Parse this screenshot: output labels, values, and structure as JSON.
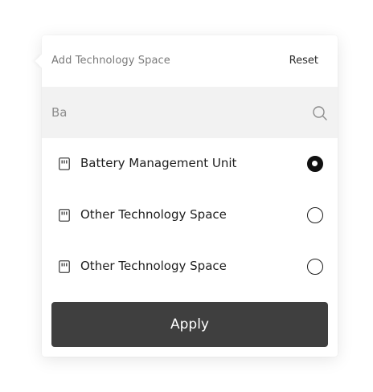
{
  "popover": {
    "title": "Add Technology Space",
    "reset_label": "Reset"
  },
  "search": {
    "value": "Ba",
    "icon": "search-icon"
  },
  "options": [
    {
      "label": "Battery Management Unit",
      "icon": "device-icon",
      "selected": true
    },
    {
      "label": "Other Technology Space",
      "icon": "device-icon",
      "selected": false
    },
    {
      "label": "Other Technology Space",
      "icon": "device-icon",
      "selected": false
    }
  ],
  "apply_label": "Apply",
  "colors": {
    "button_bg": "#3f3f3f",
    "search_bg": "#f2f2f2",
    "title_text": "#7a7a7a"
  }
}
